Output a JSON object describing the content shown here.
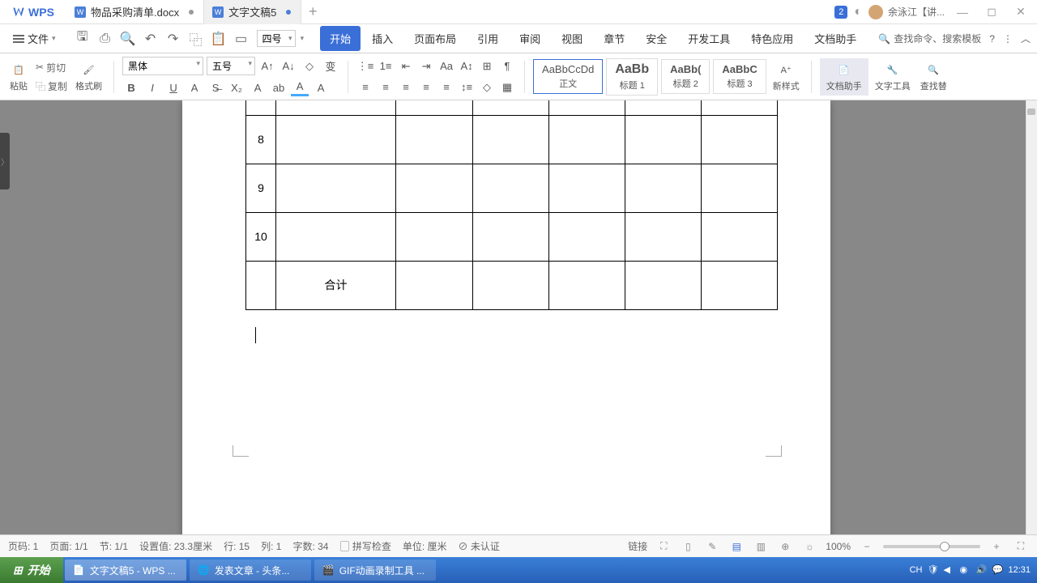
{
  "app": {
    "name": "WPS"
  },
  "tabs": [
    {
      "label": "物品采购清单.docx",
      "active": false
    },
    {
      "label": "文字文稿5",
      "active": true
    }
  ],
  "user": {
    "name": "余泳江【讲...",
    "badge": "2"
  },
  "file_menu": "文件",
  "font_size_qat": "四号",
  "ribbon_tabs": {
    "start": "开始",
    "insert": "插入",
    "layout": "页面布局",
    "reference": "引用",
    "review": "审阅",
    "view": "视图",
    "chapter": "章节",
    "security": "安全",
    "dev": "开发工具",
    "special": "特色应用",
    "helper": "文档助手"
  },
  "search_placeholder": "查找命令、搜索模板",
  "ribbon": {
    "paste": "粘贴",
    "cut": "剪切",
    "copy": "复制",
    "format_painter": "格式刷",
    "font_name": "黑体",
    "font_size": "五号",
    "style_body": "正文",
    "style_h1": "标题 1",
    "style_h2": "标题 2",
    "style_h3": "标题 3",
    "new_style": "新样式",
    "doc_helper": "文档助手",
    "text_tools": "文字工具",
    "find_replace": "查找替"
  },
  "styles_preview": {
    "body": "AaBbCcDd",
    "h1": "AaBb",
    "h2": "AaBb(",
    "h3": "AaBbC"
  },
  "table": {
    "rows": [
      {
        "num": "",
        "name": ""
      },
      {
        "num": "8",
        "name": ""
      },
      {
        "num": "9",
        "name": ""
      },
      {
        "num": "10",
        "name": ""
      },
      {
        "num": "",
        "name": "合计"
      }
    ]
  },
  "status": {
    "page_no": "页码: 1",
    "page": "页面: 1/1",
    "section": "节: 1/1",
    "position": "设置值: 23.3厘米",
    "line": "行: 15",
    "col": "列: 1",
    "words": "字数: 34",
    "spell": "拼写检查",
    "unit": "单位: 厘米",
    "cert": "未认证",
    "zoom": "100%",
    "link": "链接"
  },
  "taskbar": {
    "start": "开始",
    "items": [
      {
        "label": "文字文稿5 - WPS ..."
      },
      {
        "label": "发表文章 - 头条..."
      },
      {
        "label": "GIF动画录制工具 ..."
      }
    ],
    "lang": "CH",
    "time": "12:31"
  }
}
